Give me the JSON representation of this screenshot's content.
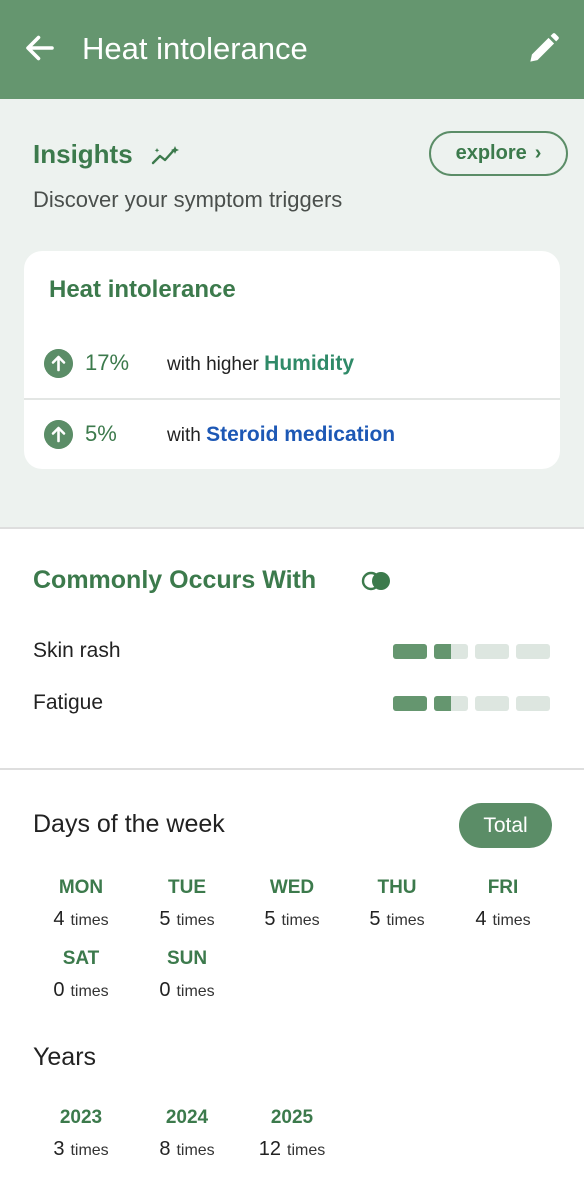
{
  "header": {
    "title": "Heat intolerance",
    "back_icon": "arrow-left-icon",
    "edit_icon": "pencil-icon"
  },
  "insights": {
    "title": "Insights",
    "icon": "sparkle-trend-icon",
    "explore_label": "explore",
    "subtitle": "Discover your symptom triggers",
    "card": {
      "title": "Heat intolerance",
      "triggers": [
        {
          "percent": "17%",
          "prefix": "with higher",
          "factor": "Humidity",
          "factor_color": "#2f8a68"
        },
        {
          "percent": "5%",
          "prefix": "with",
          "factor": "Steroid medication",
          "factor_color": "#1d58b5"
        }
      ]
    }
  },
  "commonly": {
    "title": "Commonly Occurs With",
    "icon": "overlap-circles-icon",
    "items": [
      {
        "name": "Skin rash",
        "strength": 0.375
      },
      {
        "name": "Fatigue",
        "strength": 0.375
      }
    ]
  },
  "days": {
    "title": "Days of the week",
    "total_label": "Total",
    "unit": "times",
    "items": [
      {
        "label": "MON",
        "count": "4"
      },
      {
        "label": "TUE",
        "count": "5"
      },
      {
        "label": "WED",
        "count": "5"
      },
      {
        "label": "THU",
        "count": "5"
      },
      {
        "label": "FRI",
        "count": "4"
      },
      {
        "label": "SAT",
        "count": "0"
      },
      {
        "label": "SUN",
        "count": "0"
      }
    ]
  },
  "years": {
    "title": "Years",
    "unit": "times",
    "items": [
      {
        "label": "2023",
        "count": "3"
      },
      {
        "label": "2024",
        "count": "8"
      },
      {
        "label": "2025",
        "count": "12"
      }
    ]
  },
  "colors": {
    "header": "#65966f",
    "accent": "#3c7a4c",
    "insights_bg": "#edf2ef"
  }
}
